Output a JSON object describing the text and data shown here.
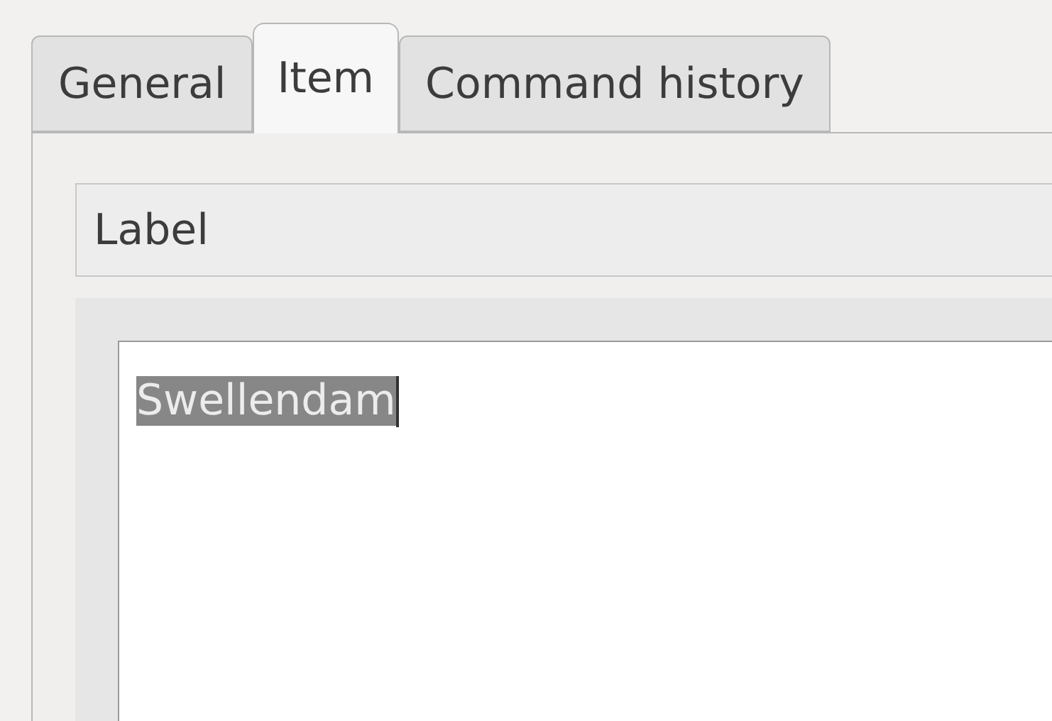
{
  "tabs": [
    {
      "label": "General",
      "selected": false
    },
    {
      "label": "Item",
      "selected": true
    },
    {
      "label": "Command history",
      "selected": false
    }
  ],
  "section": {
    "title": "Label"
  },
  "text_area": {
    "value": "Swellendam",
    "selected": true
  }
}
